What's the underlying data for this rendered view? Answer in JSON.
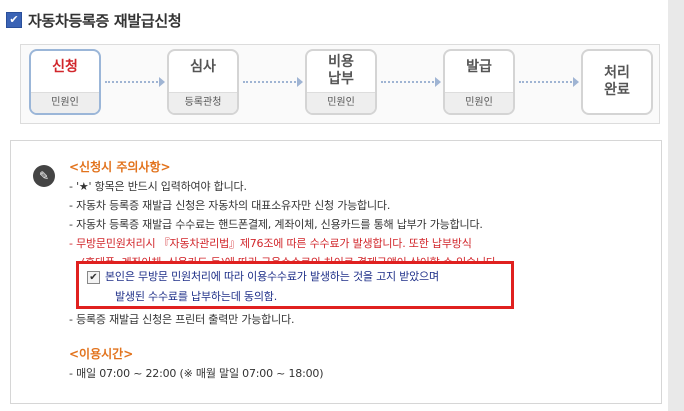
{
  "page": {
    "title": "자동차등록증 재발급신청",
    "checkbox_mark": "✔"
  },
  "steps": [
    {
      "label": "신청",
      "sub": "민원인",
      "active": true
    },
    {
      "label": "심사",
      "sub": "등록관청",
      "active": false
    },
    {
      "label": "비용\n납부",
      "sub": "민원인",
      "active": false
    },
    {
      "label": "발급",
      "sub": "민원인",
      "active": false
    },
    {
      "label": "처리\n완료",
      "sub": "",
      "active": false
    }
  ],
  "notice": {
    "icon": "speech-note-icon",
    "caution_title": "<신청시 주의사항>",
    "caution_lines": [
      "- '★' 항목은 반드시 입력하여야 합니다.",
      "- 자동차 등록증 재발급 신청은 자동차의 대표소유자만 신청 가능합니다.",
      "- 자동차 등록증 재발급 수수료는 핸드폰결제, 계좌이체, 신용카드를 통해 납부가 가능합니다.",
      "- 무방문민원처리시 『자동차관리법』제76조에 따른 수수료가 발생합니다. 또한 납부방식",
      "(휴대폰, 계좌이체, 신용카드 등)에 따라 금융수수료의 차이로 결제금액이 상이할 수 있습니다.",
      "- 등록증 재발급 신청은 프린터 출력만 가능합니다."
    ],
    "consent_line1": "본인은 무방문 민원처리에 따라 이용수수료가 발생하는 것을 고지 받았으며",
    "consent_line2": "발생된 수수료를 납부하는데 동의함.",
    "consent_checked": "✔",
    "hours_title": "<이용시간>",
    "hours_line": "- 매일 07:00 ~ 22:00 (※ 매월 말일 07:00 ~ 18:00)"
  }
}
